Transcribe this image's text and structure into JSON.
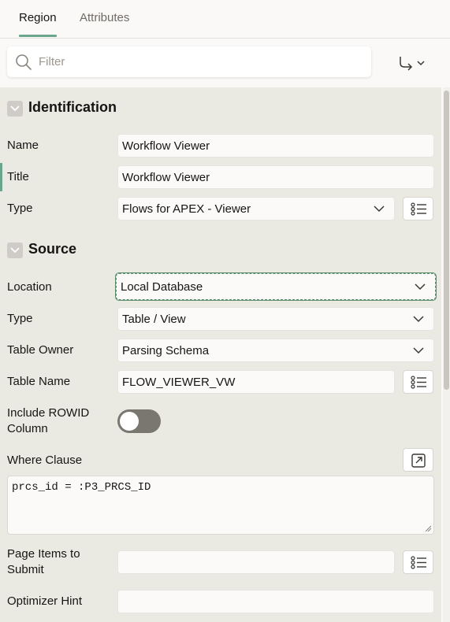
{
  "tabs": [
    {
      "label": "Region",
      "active": true
    },
    {
      "label": "Attributes",
      "active": false
    }
  ],
  "filter": {
    "placeholder": "Filter",
    "value": ""
  },
  "colors": {
    "accent": "#6aa58c",
    "panel_bg": "#eaeae3",
    "toggle_bg": "#cfccc7"
  },
  "identification": {
    "title": "Identification",
    "name": {
      "label": "Name",
      "value": "Workflow Viewer"
    },
    "title_field": {
      "label": "Title",
      "value": "Workflow Viewer"
    },
    "type": {
      "label": "Type",
      "value": "Flows for APEX - Viewer"
    }
  },
  "source": {
    "title": "Source",
    "location": {
      "label": "Location",
      "value": "Local Database"
    },
    "type": {
      "label": "Type",
      "value": "Table / View"
    },
    "table_owner": {
      "label": "Table Owner",
      "value": "Parsing Schema"
    },
    "table_name": {
      "label": "Table Name",
      "value": "FLOW_VIEWER_VW"
    },
    "include_rowid": {
      "label_line1": "Include ROWID",
      "label_line2": "Column",
      "on": false
    },
    "where_clause": {
      "label": "Where Clause",
      "value": "prcs_id = :P3_PRCS_ID"
    },
    "page_items": {
      "label_line1": "Page Items to",
      "label_line2": "Submit",
      "value": ""
    },
    "optimizer_hint": {
      "label": "Optimizer Hint",
      "value": ""
    }
  },
  "icons": {
    "search": "search-icon",
    "go_to_group": "go-to-group-icon",
    "collapse": "chevron-down-icon",
    "list": "list-icon",
    "expand": "expand-icon"
  }
}
